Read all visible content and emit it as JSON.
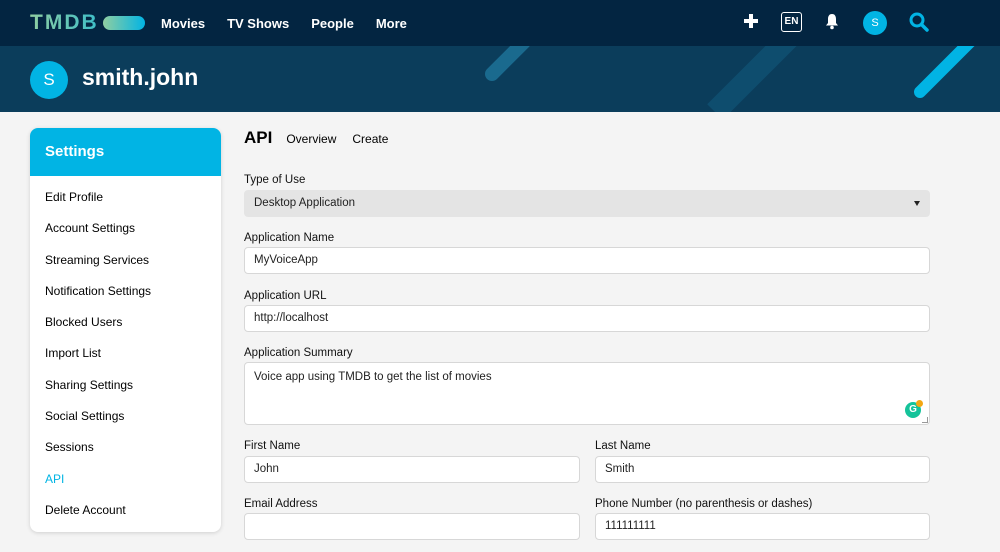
{
  "nav": {
    "logo": "TMDB",
    "links": [
      "Movies",
      "TV Shows",
      "People",
      "More"
    ],
    "lang": "EN",
    "avatar_initial": "S"
  },
  "header": {
    "avatar_initial": "S",
    "username": "smith.john"
  },
  "sidebar": {
    "title": "Settings",
    "items": [
      {
        "label": "Edit Profile"
      },
      {
        "label": "Account Settings"
      },
      {
        "label": "Streaming Services"
      },
      {
        "label": "Notification Settings"
      },
      {
        "label": "Blocked Users"
      },
      {
        "label": "Import List"
      },
      {
        "label": "Sharing Settings"
      },
      {
        "label": "Social Settings"
      },
      {
        "label": "Sessions"
      },
      {
        "label": "API",
        "active": true
      },
      {
        "label": "Delete Account"
      }
    ]
  },
  "main": {
    "title": "API",
    "tabs": [
      "Overview",
      "Create"
    ],
    "type_of_use": {
      "label": "Type of Use",
      "value": "Desktop Application"
    },
    "app_name": {
      "label": "Application Name",
      "value": "MyVoiceApp"
    },
    "app_url": {
      "label": "Application URL",
      "value": "http://localhost"
    },
    "app_summary": {
      "label": "Application Summary",
      "value": "Voice app using TMDB to get the list of movies"
    },
    "first_name": {
      "label": "First Name",
      "value": "John"
    },
    "last_name": {
      "label": "Last Name",
      "value": "Smith"
    },
    "email": {
      "label": "Email Address",
      "value": ""
    },
    "phone": {
      "label": "Phone Number (no parenthesis or dashes)",
      "value": "111111111"
    }
  },
  "colors": {
    "nav_bg": "#032541",
    "header_bg": "#0b3d5b",
    "accent": "#01b4e4",
    "logo_green": "#90cea1"
  },
  "icons": [
    "plus-icon",
    "bell-icon",
    "search-icon",
    "grammarly-icon"
  ]
}
